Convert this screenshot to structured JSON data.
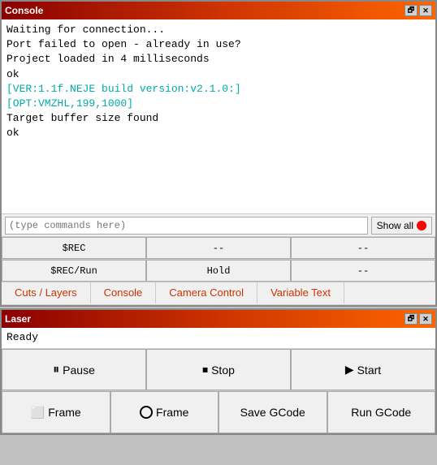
{
  "console_window": {
    "title": "Console",
    "output_lines": [
      {
        "text": "Waiting for connection...",
        "type": "normal"
      },
      {
        "text": "Port failed to open - already in use?",
        "type": "normal"
      },
      {
        "text": "Project loaded in 4 milliseconds",
        "type": "normal"
      },
      {
        "text": "ok",
        "type": "normal"
      },
      {
        "text": "[VER:1.1f.NEJE build version:v2.1.0:]",
        "type": "cyan"
      },
      {
        "text": "[OPT:VMZHL,199,1000]",
        "type": "cyan"
      },
      {
        "text": "Target buffer size found",
        "type": "normal"
      },
      {
        "text": "ok",
        "type": "normal"
      }
    ],
    "input_placeholder": "(type commands here)",
    "show_all_label": "Show all",
    "btn_row1": {
      "col1": "$REC",
      "col2": "--",
      "col3": "--"
    },
    "btn_row2": {
      "col1": "$REC/Run",
      "col2": "Hold",
      "col3": "--"
    },
    "tabs": [
      "Cuts / Layers",
      "Console",
      "Camera Control",
      "Variable Text"
    ]
  },
  "laser_window": {
    "title": "Laser",
    "status": "Ready",
    "row1": {
      "pause": "Pause",
      "stop": "Stop",
      "start": "Start"
    },
    "row2": {
      "frame1": "Frame",
      "frame2": "Frame",
      "save_gcode": "Save GCode",
      "run_gcode": "Run GCode"
    }
  }
}
